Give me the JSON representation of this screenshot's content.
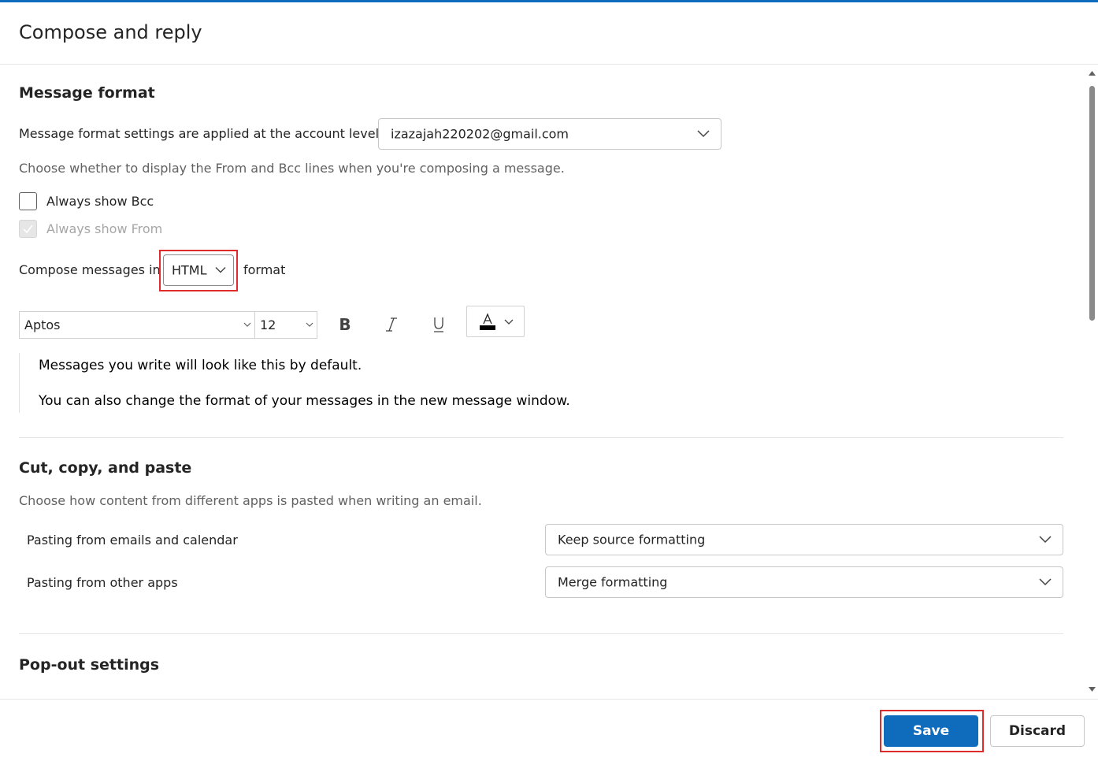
{
  "page": {
    "title": "Compose and reply",
    "accent_color": "#0f6cbd",
    "highlight_color": "#e02b2b"
  },
  "message_format": {
    "title": "Message format",
    "account_label": "Message format settings are applied at the account level:",
    "account_value": "izazajah220202@gmail.com",
    "from_bcc_hint": "Choose whether to display the From and Bcc lines when you're composing a message.",
    "always_show_bcc": {
      "label": "Always show Bcc",
      "checked": false
    },
    "always_show_from": {
      "label": "Always show From",
      "checked": true,
      "disabled": true
    },
    "compose_prefix": "Compose messages in",
    "compose_format": "HTML",
    "compose_suffix": "format",
    "font_name": "Aptos",
    "font_size": "12",
    "bold_icon": "bold-icon",
    "italic_icon": "italic-icon",
    "underline_icon": "underline-icon",
    "font_color_icon": "font-color-icon",
    "preview_line1": "Messages you write will look like this by default.",
    "preview_line2": "You can also change the format of your messages in the new message window."
  },
  "paste": {
    "title": "Cut, copy, and paste",
    "hint": "Choose how content from different apps is pasted when writing an email.",
    "emails_label": "Pasting from emails and calendar",
    "emails_value": "Keep source formatting",
    "other_label": "Pasting from other apps",
    "other_value": "Merge formatting"
  },
  "popout": {
    "title": "Pop-out settings"
  },
  "footer": {
    "save_label": "Save",
    "discard_label": "Discard"
  }
}
